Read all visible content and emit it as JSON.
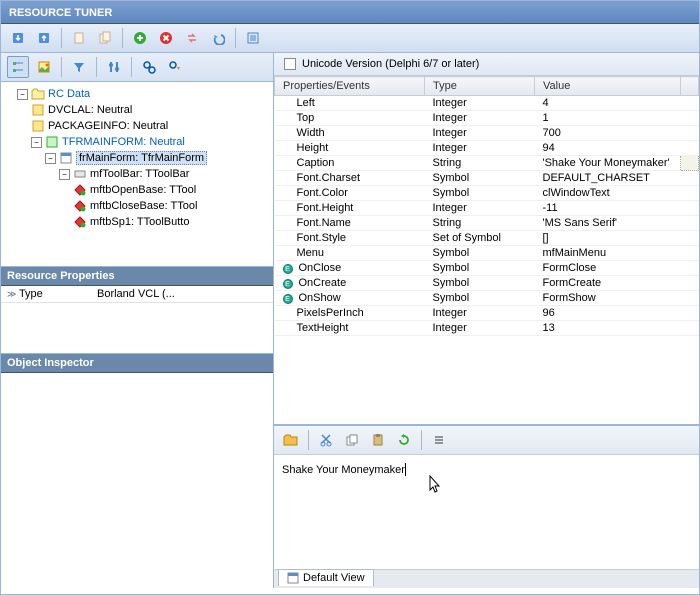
{
  "title": "RESOURCE TUNER",
  "unicodeLabel": "Unicode Version (Delphi 6/7 or later)",
  "tree": {
    "root": "RC Data",
    "n1": "DVCLAL: Neutral",
    "n2": "PACKAGEINFO: Neutral",
    "n3": "TFRMAINFORM: Neutral",
    "n4": "frMainForm: TfrMainForm",
    "n5": "mfToolBar: TToolBar",
    "n6": "mftbOpenBase: TTool",
    "n7": "mftbCloseBase: TTool",
    "n8": "mftbSp1: TToolButto"
  },
  "resourceProps": {
    "header": "Resource Properties",
    "typeK": "Type",
    "typeV": "Borland VCL (..."
  },
  "objInsp": {
    "header": "Object Inspector"
  },
  "cols": {
    "c1": "Properties/Events",
    "c2": "Type",
    "c3": "Value"
  },
  "rows": [
    {
      "p": "Left",
      "t": "Integer",
      "v": "4"
    },
    {
      "p": "Top",
      "t": "Integer",
      "v": "1"
    },
    {
      "p": "Width",
      "t": "Integer",
      "v": "700"
    },
    {
      "p": "Height",
      "t": "Integer",
      "v": "94"
    },
    {
      "p": "Caption",
      "t": "String",
      "v": "'Shake Your Moneymaker'",
      "hl": true
    },
    {
      "p": "Font.Charset",
      "t": "Symbol",
      "v": "DEFAULT_CHARSET"
    },
    {
      "p": "Font.Color",
      "t": "Symbol",
      "v": "clWindowText"
    },
    {
      "p": "Font.Height",
      "t": "Integer",
      "v": "-11"
    },
    {
      "p": "Font.Name",
      "t": "String",
      "v": "'MS Sans Serif'"
    },
    {
      "p": "Font.Style",
      "t": "Set of Symbol",
      "v": "[]"
    },
    {
      "p": "Menu",
      "t": "Symbol",
      "v": "mfMainMenu"
    },
    {
      "p": "OnClose",
      "t": "Symbol",
      "v": "FormClose",
      "ev": true
    },
    {
      "p": "OnCreate",
      "t": "Symbol",
      "v": "FormCreate",
      "ev": true
    },
    {
      "p": "OnShow",
      "t": "Symbol",
      "v": "FormShow",
      "ev": true
    },
    {
      "p": "PixelsPerInch",
      "t": "Integer",
      "v": "96"
    },
    {
      "p": "TextHeight",
      "t": "Integer",
      "v": "13"
    }
  ],
  "editor": {
    "text": "Shake Your Moneymaker"
  },
  "tab": {
    "label": "Default View"
  }
}
